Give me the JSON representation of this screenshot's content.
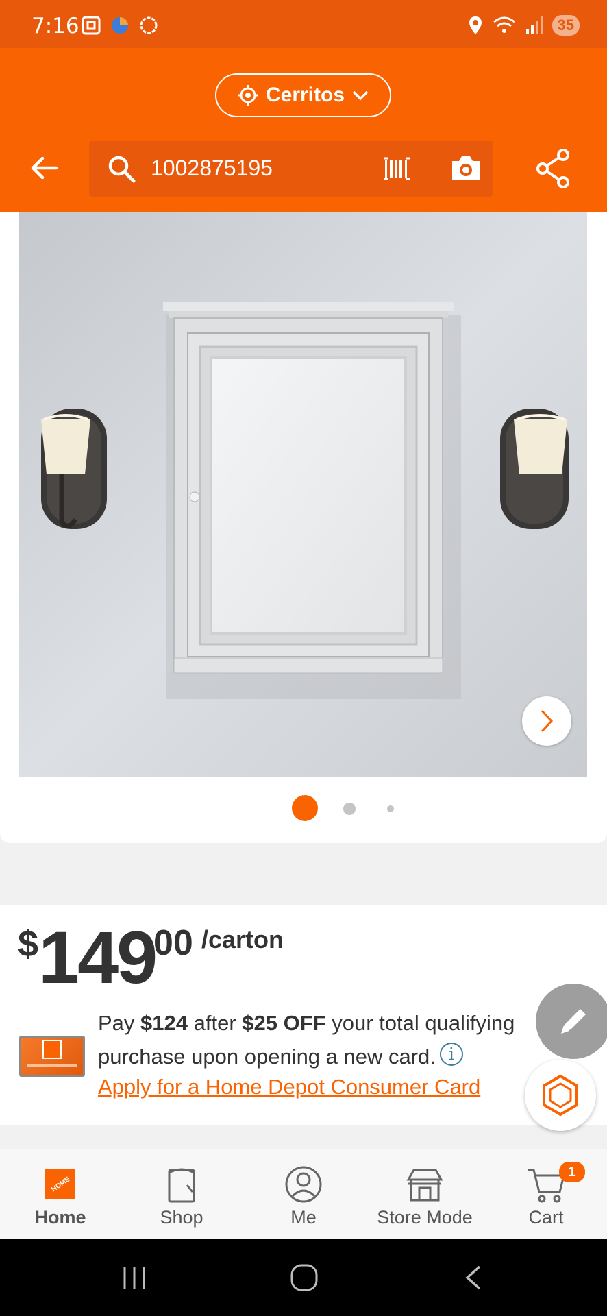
{
  "status_bar": {
    "time": "7:16",
    "battery": "35",
    "icons": [
      "screenshot-icon",
      "app-icon",
      "circle-icon",
      "location-icon",
      "wifi-icon",
      "signal-icon"
    ]
  },
  "header": {
    "store": "Cerritos",
    "search_value": "1002875195"
  },
  "carousel": {
    "active_index": 1,
    "count": 3
  },
  "price": {
    "symbol": "$",
    "dollars": "149",
    "cents": "00",
    "unit": "/carton"
  },
  "promo": {
    "prefix": "Pay ",
    "amount": "$124",
    "middle": " after ",
    "discount": "$25 OFF",
    "suffix": " your total qualifying purchase upon opening a new card.",
    "info_glyph": "i",
    "link": "Apply for a Home Depot Consumer Card"
  },
  "bottom_nav": {
    "items": [
      {
        "label": "Home",
        "icon": "home-depot-logo-icon",
        "active": true
      },
      {
        "label": "Shop",
        "icon": "shop-icon",
        "active": false
      },
      {
        "label": "Me",
        "icon": "user-icon",
        "active": false
      },
      {
        "label": "Store Mode",
        "icon": "store-icon",
        "active": false
      },
      {
        "label": "Cart",
        "icon": "cart-icon",
        "active": false
      }
    ],
    "cart_count": "1"
  },
  "colors": {
    "brand_orange": "#f96302",
    "status_bar": "#e8590c",
    "link": "#f96302"
  }
}
